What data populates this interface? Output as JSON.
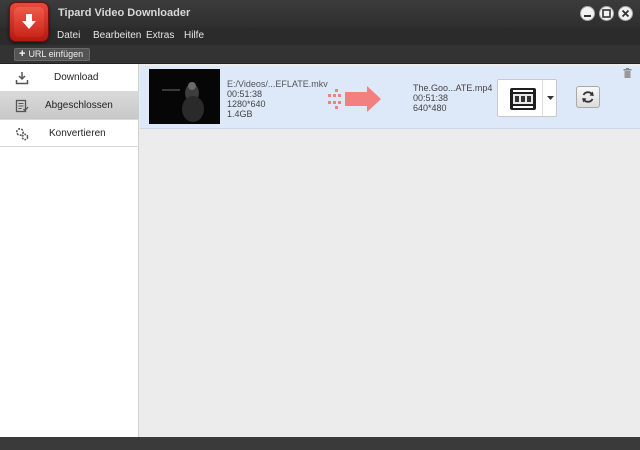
{
  "window": {
    "title": "Tipard Video Downloader"
  },
  "menu": {
    "items": [
      "Datei",
      "Bearbeiten",
      "Extras",
      "Hilfe"
    ]
  },
  "toolbar": {
    "url_button_label": "URL einfügen"
  },
  "sidebar": {
    "items": [
      {
        "label": "Download",
        "icon": "download-icon",
        "active": false
      },
      {
        "label": "Abgeschlossen",
        "icon": "completed-list-icon",
        "active": true
      },
      {
        "label": "Konvertieren",
        "icon": "convert-gear-icon",
        "active": false
      }
    ]
  },
  "task": {
    "source": {
      "name": "E:/Videos/...EFLATE.mkv",
      "duration": "00:51:38",
      "resolution": "1280*640",
      "size": "1.4GB"
    },
    "target": {
      "name": "The.Goo...ATE.mp4",
      "duration": "00:51:38",
      "resolution": "640*480"
    },
    "format_icon": "film-format-icon"
  },
  "colors": {
    "accent_red": "#d62b1f",
    "row_highlight": "#dde8f8",
    "arrow": "#f47f7f"
  }
}
